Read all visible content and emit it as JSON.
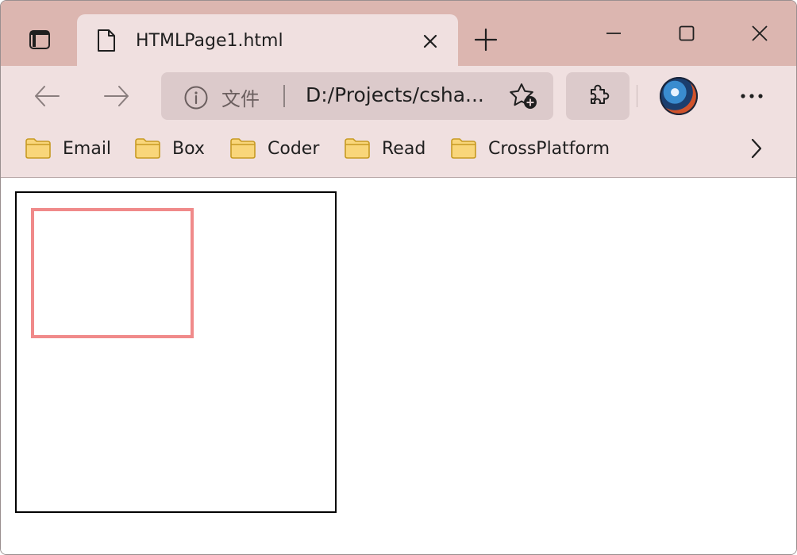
{
  "tab": {
    "title": "HTMLPage1.html"
  },
  "address_bar": {
    "security_label": "文件",
    "url": "D:/Projects/csha..."
  },
  "bookmarks": [
    {
      "label": "Email"
    },
    {
      "label": "Box"
    },
    {
      "label": "Coder"
    },
    {
      "label": "Read"
    },
    {
      "label": "CrossPlatform"
    }
  ],
  "icons": {
    "tab_actions": "tab-actions-icon",
    "favicon": "page-icon",
    "close": "close-icon",
    "new_tab": "plus-icon",
    "minimize": "minimize-icon",
    "maximize": "maximize-icon",
    "window_close": "close-icon",
    "back": "arrow-left-icon",
    "forward": "arrow-right-icon",
    "info": "info-icon",
    "add_favorite": "star-plus-icon",
    "extensions": "puzzle-icon",
    "profile": "avatar",
    "more": "more-icon",
    "bookmark_folder": "folder-icon",
    "bookmarks_overflow": "chevron-right-icon"
  },
  "colors": {
    "titlebar": "#dcb6b0",
    "toolbar": "#f0e0e0",
    "address_bar": "#dccacb",
    "outer_box_border": "#000000",
    "inner_box_border": "#f08a8a",
    "folder_fill": "#f9d67a",
    "folder_stroke": "#c79a22"
  }
}
